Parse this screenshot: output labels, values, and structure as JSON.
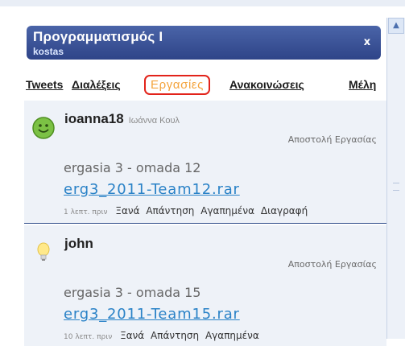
{
  "panel": {
    "title": "Προγραμματισμός Ι",
    "subtitle": "kostas",
    "close_label": "x"
  },
  "tabs": [
    {
      "label": "Tweets",
      "active": false
    },
    {
      "label": "Διαλέξεις",
      "active": false
    },
    {
      "label": "Εργασίες",
      "active": true
    },
    {
      "label": "Ανακοινώσεις",
      "active": false
    },
    {
      "label": "Μέλη",
      "active": false
    }
  ],
  "posts": [
    {
      "username": "ioanna18",
      "realname": "Ιωάννα Κουλ",
      "action_type": "Αποστολή Εργασίας",
      "text": "ergasia 3 - omada 12",
      "file": "erg3_2011-Team12.rar",
      "time": "1 λεπτ. πριν",
      "actions": [
        "Ξανά",
        "Απάντηση",
        "Αγαπημένα",
        "Διαγραφή"
      ],
      "avatar": "smiley-icon"
    },
    {
      "username": "john",
      "realname": "",
      "action_type": "Αποστολή Εργασίας",
      "text": "ergasia 3 - omada 15",
      "file": "erg3_2011-Team15.rar",
      "time": "10 λεπτ. πριν",
      "actions": [
        "Ξανά",
        "Απάντηση",
        "Αγαπημένα"
      ],
      "avatar": "lightbulb-icon"
    }
  ],
  "colors": {
    "titlebar": "#2e4488",
    "active_tab": "#f4a33c",
    "active_tab_border": "#e2231a",
    "link": "#2a82c7",
    "post_bg": "#eef2f8"
  }
}
